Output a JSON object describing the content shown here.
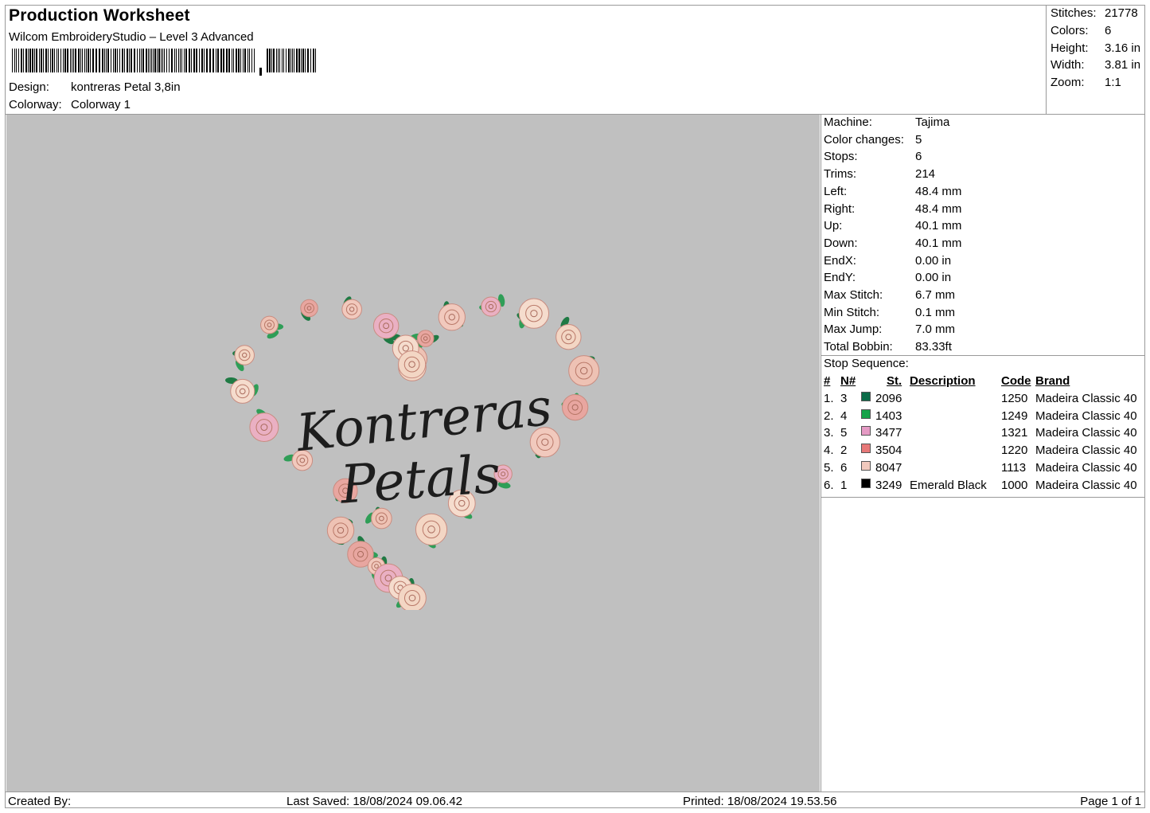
{
  "header": {
    "title": "Production Worksheet",
    "software": "Wilcom EmbroideryStudio – Level 3 Advanced",
    "design_label": "Design:",
    "design_value": "kontreras Petal 3,8in",
    "colorway_label": "Colorway:",
    "colorway_value": "Colorway 1"
  },
  "summary": [
    {
      "label": "Stitches:",
      "value": "21778"
    },
    {
      "label": "Colors:",
      "value": "6"
    },
    {
      "label": "Height:",
      "value": "3.16 in"
    },
    {
      "label": "Width:",
      "value": "3.81 in"
    },
    {
      "label": "Zoom:",
      "value": "1:1"
    }
  ],
  "machine_info": [
    {
      "label": "Machine:",
      "value": "Tajima"
    },
    {
      "label": "Color changes:",
      "value": "5"
    },
    {
      "label": "Stops:",
      "value": "6"
    },
    {
      "label": "Trims:",
      "value": "214"
    },
    {
      "label": "Left:",
      "value": "48.4 mm"
    },
    {
      "label": "Right:",
      "value": "48.4 mm"
    },
    {
      "label": "Up:",
      "value": "40.1 mm"
    },
    {
      "label": "Down:",
      "value": "40.1 mm"
    },
    {
      "label": "EndX:",
      "value": "0.00 in"
    },
    {
      "label": "EndY:",
      "value": "0.00 in"
    },
    {
      "label": "Max Stitch:",
      "value": "6.7 mm"
    },
    {
      "label": "Min Stitch:",
      "value": "0.1 mm"
    },
    {
      "label": "Max Jump:",
      "value": "7.0 mm"
    },
    {
      "label": "Total Bobbin:",
      "value": "83.33ft"
    }
  ],
  "stop_sequence": {
    "title": "Stop Sequence:",
    "headers": {
      "num": "#",
      "n": "N#",
      "st": "St.",
      "description": "Description",
      "code": "Code",
      "brand": "Brand"
    },
    "rows": [
      {
        "num": "1.",
        "n": "3",
        "color": "#0b6b48",
        "st": "2096",
        "description": "",
        "code": "1250",
        "brand": "Madeira Classic 40"
      },
      {
        "num": "2.",
        "n": "4",
        "color": "#17a34a",
        "st": "1403",
        "description": "",
        "code": "1249",
        "brand": "Madeira Classic 40"
      },
      {
        "num": "3.",
        "n": "5",
        "color": "#e59ac4",
        "st": "3477",
        "description": "",
        "code": "1321",
        "brand": "Madeira Classic 40"
      },
      {
        "num": "4.",
        "n": "2",
        "color": "#e77878",
        "st": "3504",
        "description": "",
        "code": "1220",
        "brand": "Madeira Classic 40"
      },
      {
        "num": "5.",
        "n": "6",
        "color": "#f1c9bd",
        "st": "8047",
        "description": "",
        "code": "1113",
        "brand": "Madeira Classic 40"
      },
      {
        "num": "6.",
        "n": "1",
        "color": "#000000",
        "st": "3249",
        "description": "Emerald Black",
        "code": "1000",
        "brand": "Madeira Classic 40"
      }
    ]
  },
  "design_text": {
    "line1": "Kontreras",
    "line2": "Petals"
  },
  "footer": {
    "created_by": "Created By:",
    "last_saved": "Last Saved: 18/08/2024 09.06.42",
    "printed": "Printed: 18/08/2024 19.53.56",
    "page": "Page 1 of 1"
  },
  "colors": {
    "preview_bg": "#c0c0c0",
    "border": "#9a9a9a"
  }
}
